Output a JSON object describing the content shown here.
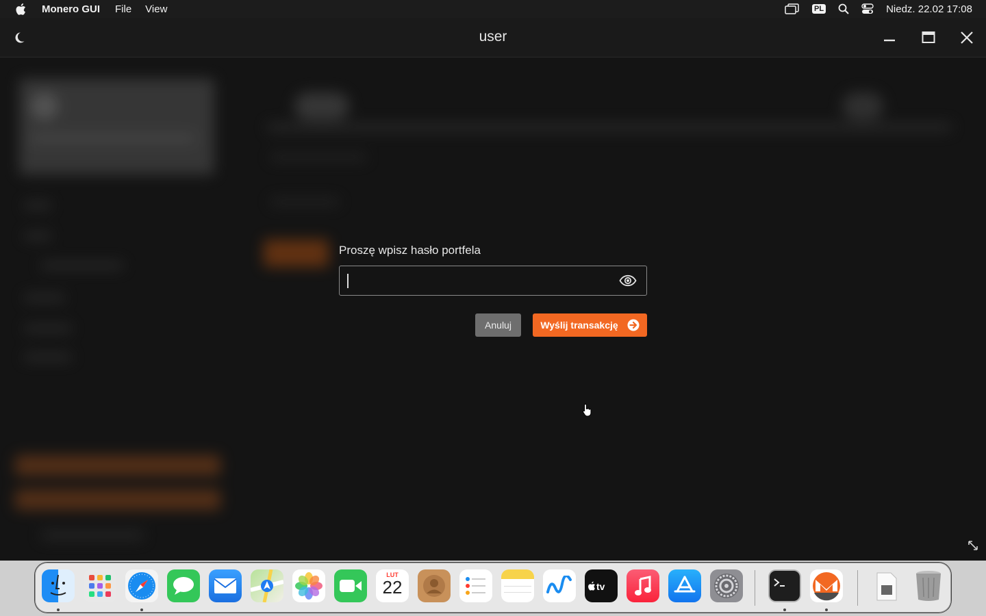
{
  "menubar": {
    "app_name": "Monero GUI",
    "menus": [
      "File",
      "View"
    ],
    "keyboard_layout": "PL",
    "clock": "Niedz. 22.02  17:08"
  },
  "window": {
    "title": "user"
  },
  "dialog": {
    "prompt": "Proszę wpisz hasło portfela",
    "password_value": "",
    "cancel_label": "Anuluj",
    "send_label": "Wyślij transakcję"
  },
  "colors": {
    "accent": "#f26822",
    "window_bg": "#141414",
    "cancel_bg": "#6e6e6e"
  },
  "dock": {
    "calendar_month": "LUT",
    "calendar_day": "22",
    "apps": [
      "finder-icon",
      "launchpad-icon",
      "safari-icon",
      "messages-icon",
      "mail-icon",
      "maps-icon",
      "photos-icon",
      "facetime-icon",
      "calendar-icon",
      "contacts-icon",
      "reminders-icon",
      "notes-icon",
      "freeform-icon",
      "appletv-icon",
      "music-icon",
      "appstore-icon",
      "system-settings-icon",
      "terminal-icon",
      "monero-icon",
      "downloads-icon",
      "trash-icon"
    ]
  }
}
